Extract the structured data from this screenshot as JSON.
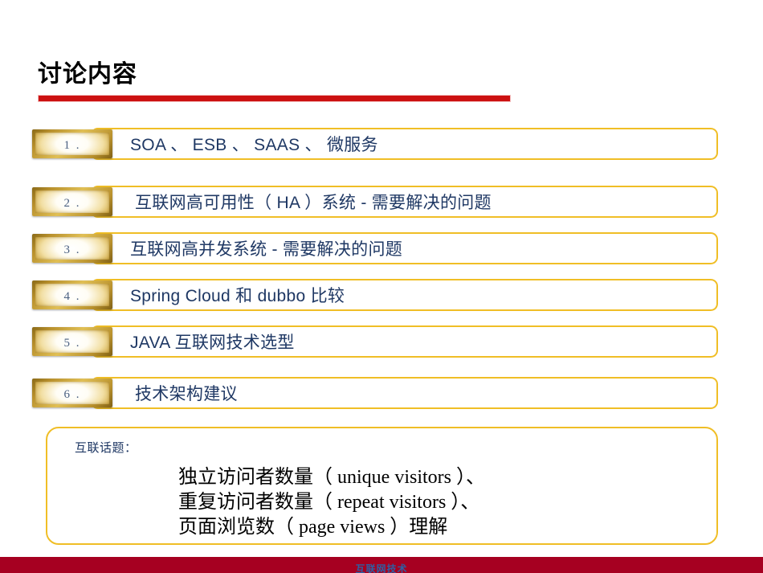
{
  "slide": {
    "title": "讨论内容",
    "accent_red": "#CC1111",
    "accent_gold": "#F0BE26",
    "text_navy": "#1F3864",
    "footer_red": "#A60021"
  },
  "agenda": {
    "items": [
      {
        "number": "1 .",
        "label": "SOA 、 ESB 、 SAAS 、 微服务"
      },
      {
        "number": "2 .",
        "label": "互联网高可用性（ HA ）系统 - 需要解决的问题"
      },
      {
        "number": "3 .",
        "label": "互联网高并发系统 - 需要解决的问题"
      },
      {
        "number": "4 .",
        "label": "Spring Cloud 和 dubbo 比较"
      },
      {
        "number": "5 .",
        "label": "JAVA 互联网技术选型"
      },
      {
        "number": "6 .",
        "label": "技术架构建议"
      }
    ]
  },
  "note": {
    "heading": "互联话题：",
    "lines": [
      "独立访问者数量（ unique visitors ）、",
      "重复访问者数量（ repeat visitors ）、",
      "页面浏览数（ page views ）理解"
    ]
  },
  "footer": {
    "text": "互联网技术"
  }
}
